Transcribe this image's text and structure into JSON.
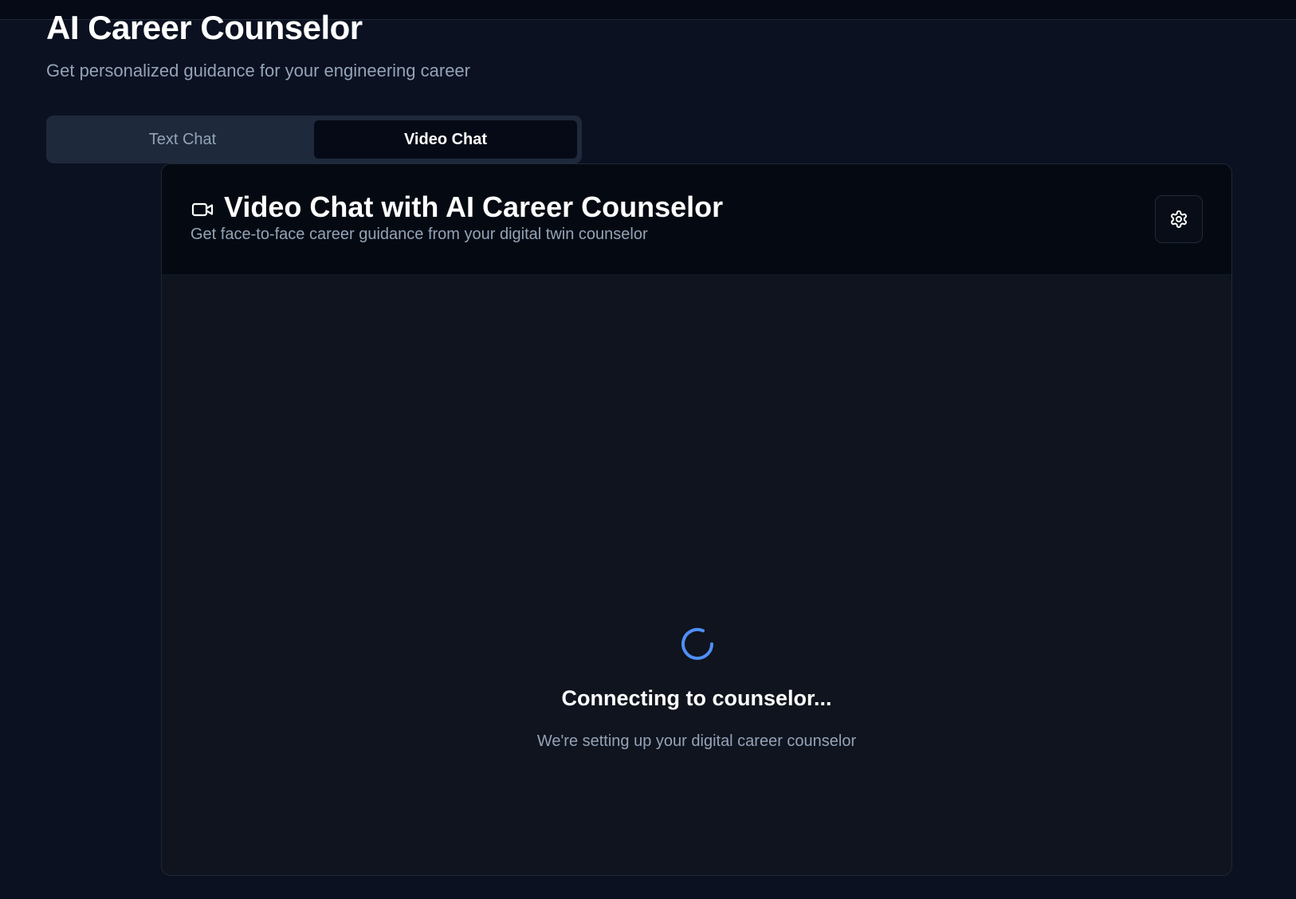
{
  "page": {
    "title": "AI Career Counselor",
    "subtitle": "Get personalized guidance for your engineering career"
  },
  "tabs": [
    {
      "label": "Text Chat",
      "active": false
    },
    {
      "label": "Video Chat",
      "active": true
    }
  ],
  "video_chat": {
    "icon": "video-camera-icon",
    "title": "Video Chat with AI Career Counselor",
    "subtitle": "Get face-to-face career guidance from your digital twin counselor",
    "settings_icon": "gear-icon",
    "status_icon": "loading-spinner-icon",
    "status_title": "Connecting to counselor...",
    "status_text": "We're setting up your digital career counselor"
  },
  "colors": {
    "background": "#0b1120",
    "tab_bar": "#1e293b",
    "active_tab": "#050a16",
    "muted_text": "#94a3b8",
    "spinner": "#4f8ff7"
  }
}
